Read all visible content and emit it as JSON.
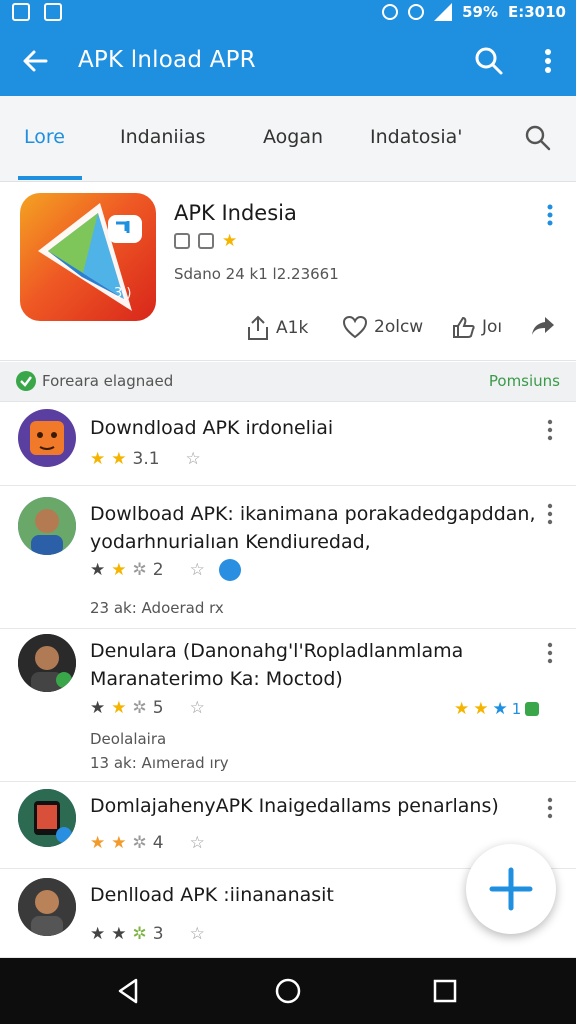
{
  "status_bar": {
    "battery": "59%",
    "time": "E:3010"
  },
  "app_bar": {
    "title": "APK lnload APR",
    "back_icon": "arrow-left-icon",
    "search_icon": "search-icon",
    "more_icon": "more-vert-icon"
  },
  "tabs": [
    {
      "label": "Lore",
      "active": true
    },
    {
      "label": "Indaniias",
      "active": false
    },
    {
      "label": "Aogan",
      "active": false
    },
    {
      "label": "Indatosia'",
      "active": false
    }
  ],
  "app": {
    "name": "APK Indesia",
    "meta": "Sdano 24 k1 l2.23661",
    "actions": {
      "install": "A1k",
      "like": "2olcw",
      "thumb": "Joı"
    }
  },
  "section": {
    "label": "Foreara elagnaed",
    "link": "Pomsiuns"
  },
  "items": [
    {
      "title": "Downdload APK irdoneliai",
      "rating_value": "3.1"
    },
    {
      "title": "Dowlboad APK: ikanimana porakadedgapddan,",
      "subtitle": "yodarhnurialıan Kendiuredad,",
      "rating_value": "2",
      "meta": "23 ak: Adoerad rx"
    },
    {
      "title": "Denulara (Danonahg'l'Ropladlanmlama",
      "subtitle": "Maranaterimo Ka: Moctod)",
      "rating_value": "5",
      "meta_1": "Deolalaira",
      "meta_2": "13 ak: Aımerad ıry",
      "right_rating": "1"
    },
    {
      "title": "DomlajahenyAPK Inaigedallams penarlans)",
      "rating_value": "4"
    },
    {
      "title": "Denlload APK :iinananasit",
      "rating_value": "3"
    }
  ],
  "fab": {
    "icon": "plus-icon"
  },
  "nav": {
    "back": "nav-back-icon",
    "home": "nav-home-icon",
    "recents": "nav-recents-icon"
  },
  "colors": {
    "primary": "#1f8fe0",
    "star": "#f5b400",
    "success": "#3aa64a"
  }
}
